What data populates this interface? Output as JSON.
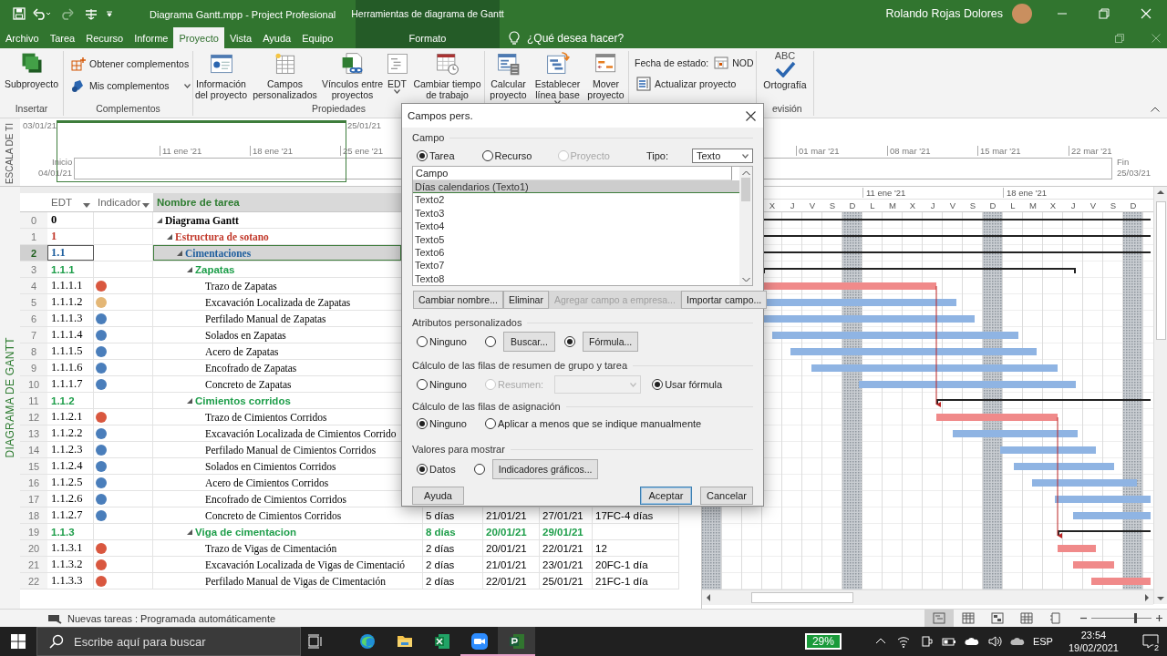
{
  "title_bar": {
    "title": "Diagrama Gantt.mpp - Project Profesional",
    "context_title": "Herramientas de diagrama de Gantt",
    "user": "Rolando Rojas Dolores"
  },
  "tabs": [
    {
      "label": "Archivo",
      "selected": false,
      "kind": "standard"
    },
    {
      "label": "Tarea",
      "selected": false,
      "kind": "standard"
    },
    {
      "label": "Recurso",
      "selected": false,
      "kind": "standard"
    },
    {
      "label": "Informe",
      "selected": false,
      "kind": "standard"
    },
    {
      "label": "Proyecto",
      "selected": true,
      "kind": "standard"
    },
    {
      "label": "Vista",
      "selected": false,
      "kind": "standard"
    },
    {
      "label": "Ayuda",
      "selected": false,
      "kind": "standard"
    },
    {
      "label": "Equipo",
      "selected": false,
      "kind": "standard"
    },
    {
      "label": "Formato",
      "selected": false,
      "kind": "contextual"
    }
  ],
  "tell_me": "¿Qué desea hacer?",
  "ribbon": {
    "groups": [
      {
        "label": "Insertar",
        "commands": [
          {
            "kind": "large",
            "label": "Subproyecto"
          }
        ]
      },
      {
        "label": "Complementos",
        "commands": [
          {
            "kind": "small",
            "label": "Obtener complementos"
          },
          {
            "kind": "small",
            "label": "Mis complementos",
            "dropdown": true
          }
        ]
      },
      {
        "label": "Propiedades",
        "commands": [
          {
            "kind": "large",
            "label": "Información del proyecto"
          },
          {
            "kind": "large",
            "label": "Campos personalizados"
          },
          {
            "kind": "large",
            "label": "Vínculos entre proyectos"
          },
          {
            "kind": "large",
            "label": "EDT",
            "dropdown": true
          },
          {
            "kind": "large",
            "label": "Cambiar tiempo de trabajo"
          }
        ]
      },
      {
        "commands": [
          {
            "kind": "large",
            "label": "Calcular proyecto"
          },
          {
            "kind": "large",
            "label": "Establecer línea base",
            "dropdown": true
          },
          {
            "kind": "large",
            "label": "Mover proyecto"
          }
        ]
      },
      {
        "commands": [
          {
            "kind": "small",
            "label": "Fecha de estado:",
            "value": "NOD"
          },
          {
            "kind": "small",
            "label": "Actualizar proyecto"
          }
        ]
      },
      {
        "label": "evisión",
        "commands": [
          {
            "kind": "large",
            "label": "Ortografía",
            "icon_text": "ABC"
          }
        ]
      }
    ]
  },
  "timeline": {
    "side_label": "ESCALA DE TI",
    "left_date": "03/01/21",
    "right_date": "25/01/21",
    "ticks": [
      "11 ene '21",
      "18 ene '21",
      "25 ene '21",
      "01 mar '21",
      "08 mar '21",
      "15 mar '21",
      "22 mar '21"
    ],
    "start_label": "Inicio",
    "start_date": "04/01/21",
    "end_label": "Fin",
    "end_date": "25/03/21"
  },
  "table": {
    "view_label": "DIAGRAMA DE GANTT",
    "columns": [
      {
        "label": "EDT",
        "selected": false,
        "filter": true
      },
      {
        "label": "Indicador",
        "selected": false,
        "filter": true
      },
      {
        "label": "Nombre de tarea",
        "selected": true
      }
    ],
    "tasks": [
      {
        "number": "0",
        "edt": "0",
        "name": "Diagrama Gantt",
        "selected": false,
        "expanded": true,
        "children": [
          {
            "number": "1",
            "edt": "1",
            "name": "Estructura de sotano",
            "selected": false,
            "expanded": true,
            "children": [
              {
                "number": "2",
                "edt": "1.1",
                "name": "Cimentaciones",
                "selected": true,
                "expanded": true,
                "children": [
                  {
                    "number": "3",
                    "edt": "1.1.1",
                    "name": "Zapatas",
                    "selected": false,
                    "expanded": true,
                    "children": [
                      {
                        "number": "4",
                        "edt": "1.1.1.1",
                        "name": "Trazo de Zapatas",
                        "selected": false,
                        "color": "#d9573f"
                      },
                      {
                        "number": "5",
                        "edt": "1.1.1.2",
                        "name": "Excavación Localizada de Zapatas",
                        "selected": false,
                        "color": "#e4b776"
                      },
                      {
                        "number": "6",
                        "edt": "1.1.1.3",
                        "name": "Perfilado Manual de Zapatas",
                        "selected": false,
                        "color": "#4a7ebb"
                      },
                      {
                        "number": "7",
                        "edt": "1.1.1.4",
                        "name": "Solados en Zapatas",
                        "selected": false,
                        "color": "#4a7ebb"
                      },
                      {
                        "number": "8",
                        "edt": "1.1.1.5",
                        "name": "Acero de Zapatas",
                        "selected": false,
                        "color": "#4a7ebb"
                      },
                      {
                        "number": "9",
                        "edt": "1.1.1.6",
                        "name": "Encofrado de Zapatas",
                        "selected": false,
                        "color": "#4a7ebb"
                      },
                      {
                        "number": "10",
                        "edt": "1.1.1.7",
                        "name": "Concreto de Zapatas",
                        "selected": false,
                        "color": "#4a7ebb"
                      }
                    ]
                  },
                  {
                    "number": "11",
                    "edt": "1.1.2",
                    "name": "Cimientos corridos",
                    "selected": false,
                    "expanded": true,
                    "children": [
                      {
                        "number": "12",
                        "edt": "1.1.2.1",
                        "name": "Trazo de Cimientos Corridos",
                        "selected": false,
                        "color": "#d9573f"
                      },
                      {
                        "number": "13",
                        "edt": "1.1.2.2",
                        "name": "Excavación Localizada de Cimientos Corrido",
                        "selected": false,
                        "color": "#4a7ebb"
                      },
                      {
                        "number": "14",
                        "edt": "1.1.2.3",
                        "name": "Perfilado Manual de Cimientos Corridos",
                        "selected": false,
                        "color": "#4a7ebb"
                      },
                      {
                        "number": "15",
                        "edt": "1.1.2.4",
                        "name": "Solados en Cimientos Corridos",
                        "selected": false,
                        "color": "#4a7ebb"
                      },
                      {
                        "number": "16",
                        "edt": "1.1.2.5",
                        "name": "Acero de Cimientos Corridos",
                        "selected": false,
                        "color": "#4a7ebb"
                      },
                      {
                        "number": "17",
                        "edt": "1.1.2.6",
                        "name": "Encofrado de Cimientos Corridos",
                        "selected": false,
                        "color": "#4a7ebb"
                      },
                      {
                        "number": "18",
                        "edt": "1.1.2.7",
                        "name": "Concreto de Cimientos Corridos",
                        "selected": false,
                        "color": "#4a7ebb",
                        "duration": "5 días",
                        "start": "21/01/21",
                        "finish": "27/01/21",
                        "predecessors": "17FC-4 días"
                      }
                    ]
                  },
                  {
                    "number": "19",
                    "edt": "1.1.3",
                    "name": "Viga de cimentacion",
                    "selected": false,
                    "expanded": true,
                    "duration": "8 días",
                    "start": "20/01/21",
                    "finish": "29/01/21",
                    "children": [
                      {
                        "number": "20",
                        "edt": "1.1.3.1",
                        "name": "Trazo de Vigas de Cimentación",
                        "selected": false,
                        "color": "#d9573f",
                        "duration": "2 días",
                        "start": "20/01/21",
                        "finish": "22/01/21",
                        "predecessors": "12"
                      },
                      {
                        "number": "21",
                        "edt": "1.1.3.2",
                        "name": "Excavación Localizada de Vigas de Cimentació",
                        "selected": false,
                        "color": "#d9573f",
                        "duration": "2 días",
                        "start": "21/01/21",
                        "finish": "23/01/21",
                        "predecessors": "20FC-1 día"
                      },
                      {
                        "number": "22",
                        "edt": "1.1.3.3",
                        "name": "Perfilado Manual de Vigas de Cimentación",
                        "selected": false,
                        "color": "#d9573f",
                        "duration": "2 días",
                        "start": "22/01/21",
                        "finish": "25/01/21",
                        "predecessors": "21FC-1 día"
                      }
                    ]
                  }
                ]
              }
            ]
          }
        ]
      }
    ]
  },
  "gantt": {
    "weeks": [
      "11 ene '21",
      "18 ene '21"
    ],
    "days": [
      "X",
      "J",
      "V",
      "S",
      "D",
      "L",
      "M",
      "X",
      "J",
      "V",
      "S",
      "D",
      "L",
      "M",
      "X",
      "J",
      "V",
      "S",
      "D"
    ]
  },
  "dialog": {
    "title": "Campos pers.",
    "field_section": "Campo",
    "entity_options": [
      {
        "label": "Tarea",
        "selected": true,
        "disabled": false
      },
      {
        "label": "Recurso",
        "selected": false,
        "disabled": false
      },
      {
        "label": "Proyecto",
        "selected": false,
        "disabled": true
      }
    ],
    "type_label": "Tipo:",
    "type_value": "Texto",
    "list_header": "Campo",
    "fields": [
      {
        "label": "Días calendarios (Texto1)",
        "selected": true
      },
      {
        "label": "Texto2",
        "selected": false
      },
      {
        "label": "Texto3",
        "selected": false
      },
      {
        "label": "Texto4",
        "selected": false
      },
      {
        "label": "Texto5",
        "selected": false
      },
      {
        "label": "Texto6",
        "selected": false
      },
      {
        "label": "Texto7",
        "selected": false
      },
      {
        "label": "Texto8",
        "selected": false
      }
    ],
    "list_buttons": [
      {
        "label": "Cambiar nombre...",
        "disabled": false
      },
      {
        "label": "Eliminar",
        "disabled": false
      },
      {
        "label": "Agregar campo a empresa...",
        "disabled": true
      },
      {
        "label": "Importar campo...",
        "disabled": false
      }
    ],
    "sections": [
      {
        "title": "Atributos personalizados",
        "options": [
          {
            "kind": "radio",
            "label": "Ninguno",
            "selected": false,
            "disabled": false
          },
          {
            "kind": "radio_button",
            "label": "Buscar...",
            "selected": false,
            "disabled": false
          },
          {
            "kind": "radio_button",
            "label": "Fórmula...",
            "selected": true,
            "disabled": false
          }
        ]
      },
      {
        "title": "Cálculo de las filas de resumen de grupo y tarea",
        "options": [
          {
            "kind": "radio",
            "label": "Ninguno",
            "selected": false,
            "disabled": false
          },
          {
            "kind": "radio_dropdown",
            "label": "Resumen:",
            "selected": false,
            "disabled": true
          },
          {
            "kind": "radio",
            "label": "Usar fórmula",
            "selected": true,
            "disabled": false
          }
        ]
      },
      {
        "title": "Cálculo de las filas de asignación",
        "options": [
          {
            "kind": "radio",
            "label": "Ninguno",
            "selected": true,
            "disabled": false
          },
          {
            "kind": "radio",
            "label": "Aplicar a menos que se indique manualmente",
            "selected": false,
            "disabled": false
          }
        ]
      },
      {
        "title": "Valores para mostrar",
        "options": [
          {
            "kind": "radio",
            "label": "Datos",
            "selected": true,
            "disabled": false
          },
          {
            "kind": "radio_button",
            "label": "Indicadores gráficos...",
            "selected": false,
            "disabled": false
          }
        ]
      }
    ],
    "help_button": "Ayuda",
    "ok_button": "Aceptar",
    "cancel_button": "Cancelar"
  },
  "status_bar": {
    "text": "Nuevas tareas : Programada automáticamente",
    "views": [
      {
        "selected": true
      },
      {
        "selected": false
      },
      {
        "selected": false
      },
      {
        "selected": false
      },
      {
        "selected": false
      }
    ],
    "zoom": {
      "level": 0.72
    }
  },
  "taskbar": {
    "search": {
      "placeholder": "Escribe aquí para buscar"
    },
    "apps": [
      {
        "running": false,
        "selected": false
      },
      {
        "running": false,
        "selected": false
      },
      {
        "running": false,
        "selected": false
      },
      {
        "running": true,
        "selected": false
      },
      {
        "running": true,
        "selected": true
      }
    ],
    "battery": "29%",
    "language": "ESP",
    "time": "23:54",
    "date": "19/02/2021",
    "notifications": "2"
  }
}
